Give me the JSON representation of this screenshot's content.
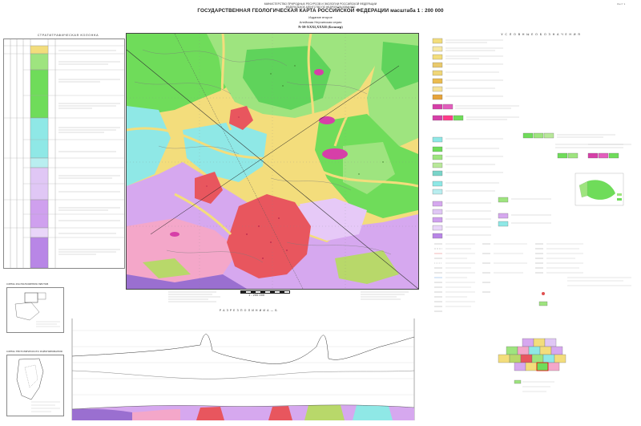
{
  "header": {
    "ministry": "МИНИСТЕРСТВО ПРИРОДНЫХ РЕСУРСОВ И ЭКОЛОГИИ РОССИЙСКОЙ ФЕДЕРАЦИИ",
    "agency": "ФЕДЕРАЛЬНОЕ АГЕНТСТВО ПО НЕДРОПОЛЬЗОВАНИЮ",
    "title": "ГОСУДАРСТВЕННАЯ ГЕОЛОГИЧЕСКАЯ КАРТА РОССИЙСКОЙ ФЕДЕРАЦИИ масштаба 1 : 200 000",
    "edition": "Издание второе",
    "series": "Алейская Нерчинская серия",
    "sheet": "N-59-XXXI,XXXII (Белозер)",
    "sheet_number": "Лист 1"
  },
  "strat_column": {
    "title": "СТРАТИГРАФИЧЕСКАЯ КОЛОНКА"
  },
  "legend": {
    "title": "У С Л О В Н Ы Е   О Б О З Н А Ч Е Н И Я"
  },
  "map": {
    "scale_label": "1 : 200 000"
  },
  "section": {
    "title": "Р А З Р Е З   П О   Л И Н И И   А — Б"
  },
  "insets": {
    "left_top_title": "СХЕМА РАСПОЛОЖЕНИЯ ЛИСТОВ",
    "left_bottom_title": "СХЕМА ТЕКТОНИЧЕСКОГО РАЙОНИРОВАНИЯ"
  },
  "colors": {
    "alluvium": "#f3dd7c",
    "green_light": "#9ee47f",
    "green_mid": "#5fd35b",
    "cyan": "#8fe8e6",
    "lilac": "#d6a8ef",
    "pink": "#f4a7c9",
    "granite_red": "#e8565e",
    "magenta": "#d63fa8",
    "olive": "#b8d86a"
  }
}
